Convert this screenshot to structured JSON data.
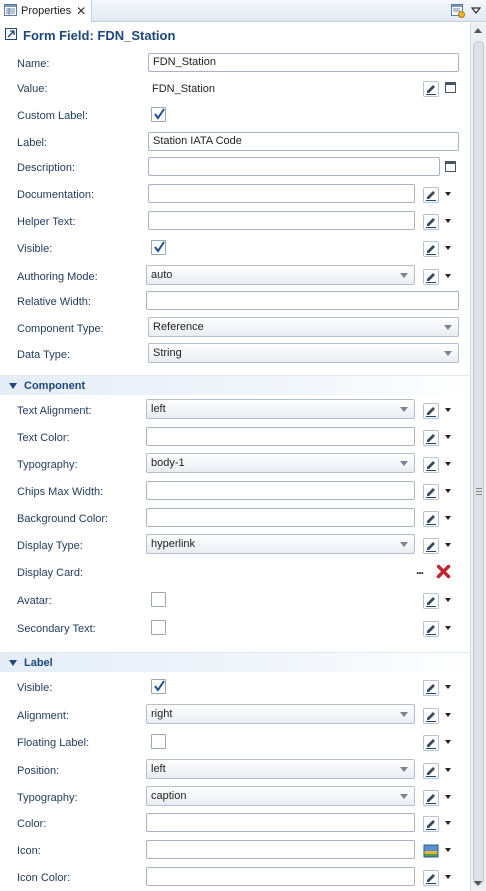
{
  "tab": {
    "title": "Properties",
    "close": "✕"
  },
  "header": {
    "title": "Form Field: FDN_Station"
  },
  "general": {
    "name": {
      "label": "Name:",
      "value": "FDN_Station"
    },
    "value": {
      "label": "Value:",
      "value": "FDN_Station"
    },
    "custom_label": {
      "label": "Custom Label:",
      "checked": true
    },
    "label": {
      "label": "Label:",
      "value": "Station IATA Code"
    },
    "description": {
      "label": "Description:",
      "value": ""
    },
    "documentation": {
      "label": "Documentation:",
      "value": ""
    },
    "helper_text": {
      "label": "Helper Text:",
      "value": ""
    },
    "visible": {
      "label": "Visible:",
      "checked": true
    },
    "authoring_mode": {
      "label": "Authoring Mode:",
      "value": "auto"
    },
    "relative_width": {
      "label": "Relative Width:",
      "value": ""
    },
    "component_type": {
      "label": "Component Type:",
      "value": "Reference"
    },
    "data_type": {
      "label": "Data Type:",
      "value": "String"
    }
  },
  "component_section": {
    "title": "Component",
    "text_alignment": {
      "label": "Text Alignment:",
      "value": "left"
    },
    "text_color": {
      "label": "Text Color:",
      "value": ""
    },
    "typography": {
      "label": "Typography:",
      "value": "body-1"
    },
    "chips_max_width": {
      "label": "Chips Max Width:",
      "value": ""
    },
    "background_color": {
      "label": "Background Color:",
      "value": ""
    },
    "display_type": {
      "label": "Display Type:",
      "value": "hyperlink"
    },
    "display_card": {
      "label": "Display Card:",
      "ellipsis": "..."
    },
    "avatar": {
      "label": "Avatar:",
      "checked": false
    },
    "secondary_text": {
      "label": "Secondary Text:",
      "checked": false
    }
  },
  "label_section": {
    "title": "Label",
    "visible": {
      "label": "Visible:",
      "checked": true
    },
    "alignment": {
      "label": "Alignment:",
      "value": "right"
    },
    "floating_label": {
      "label": "Floating Label:",
      "checked": false
    },
    "position": {
      "label": "Position:",
      "value": "left"
    },
    "typography": {
      "label": "Typography:",
      "value": "caption"
    },
    "color": {
      "label": "Color:",
      "value": ""
    },
    "icon": {
      "label": "Icon:",
      "value": ""
    },
    "icon_color": {
      "label": "Icon Color:",
      "value": ""
    }
  },
  "icons": {
    "tab": "properties-icon",
    "edit": "pencil-edit-icon",
    "dropdown": "chevron-down-icon",
    "delete": "red-x-delete-icon",
    "image": "image-picker-icon"
  },
  "colors": {
    "label_text": "#1f3a5c",
    "section_title": "#1d4778",
    "check": "#1d4f91",
    "delete": "#c0282d"
  }
}
